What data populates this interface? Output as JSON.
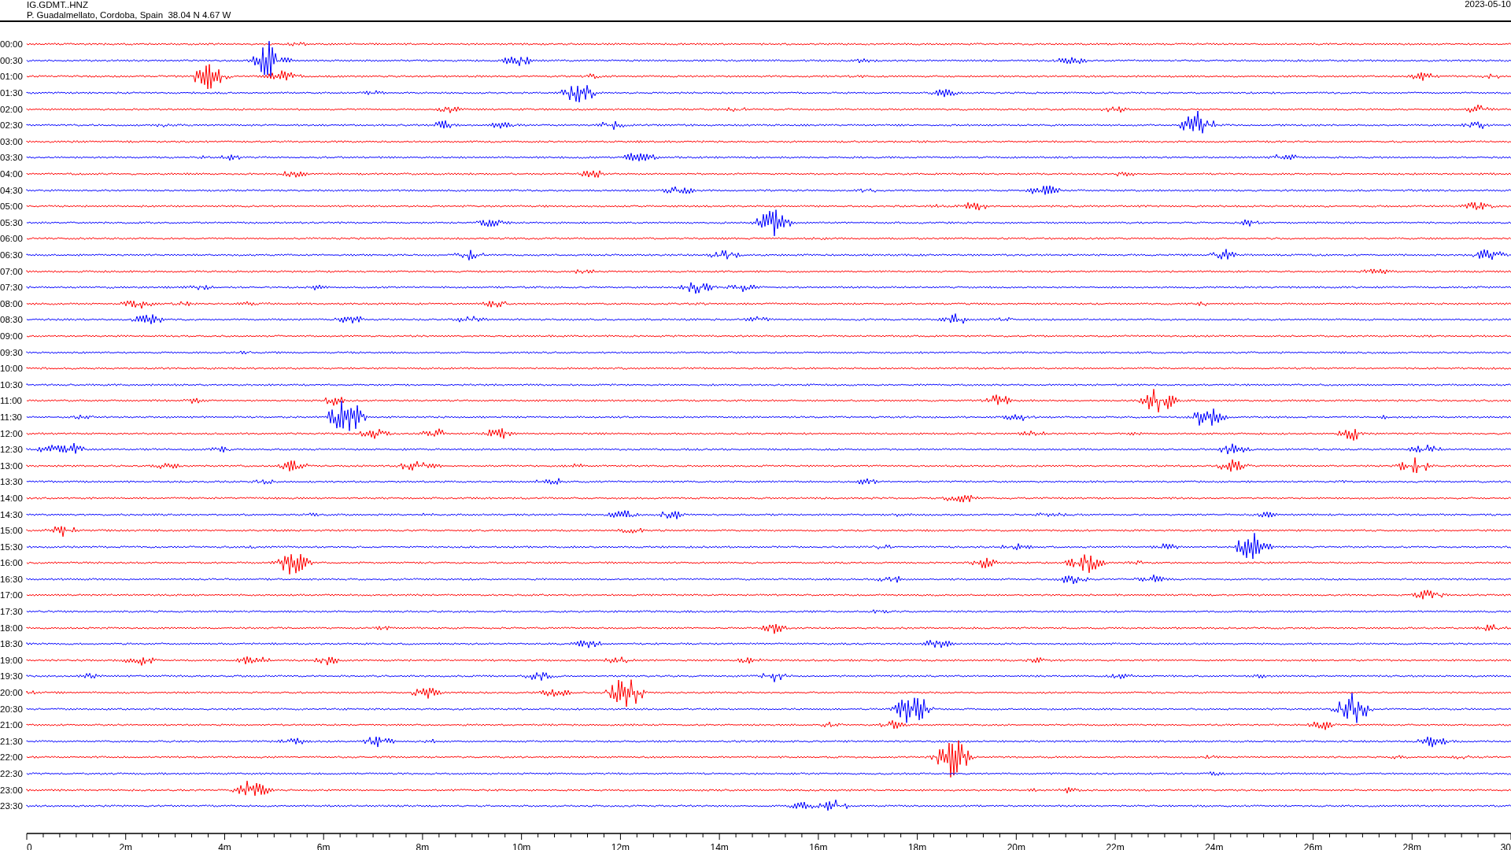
{
  "header": {
    "station": "IG.GDMT..HNZ",
    "location": "P. Guadalmellato, Cordoba, Spain  38.04 N 4.67 W",
    "date": "2023-05-10"
  },
  "rows": [
    {
      "time": "00:00",
      "color": "#ff0000"
    },
    {
      "time": "00:30",
      "color": "#0000ff"
    },
    {
      "time": "01:00",
      "color": "#ff0000"
    },
    {
      "time": "01:30",
      "color": "#0000ff"
    },
    {
      "time": "02:00",
      "color": "#ff0000"
    },
    {
      "time": "02:30",
      "color": "#0000ff"
    },
    {
      "time": "03:00",
      "color": "#ff0000"
    },
    {
      "time": "03:30",
      "color": "#0000ff"
    },
    {
      "time": "04:00",
      "color": "#ff0000"
    },
    {
      "time": "04:30",
      "color": "#0000ff"
    },
    {
      "time": "05:00",
      "color": "#ff0000"
    },
    {
      "time": "05:30",
      "color": "#0000ff"
    },
    {
      "time": "06:00",
      "color": "#ff0000"
    },
    {
      "time": "06:30",
      "color": "#0000ff"
    },
    {
      "time": "07:00",
      "color": "#ff0000"
    },
    {
      "time": "07:30",
      "color": "#0000ff"
    },
    {
      "time": "08:00",
      "color": "#ff0000"
    },
    {
      "time": "08:30",
      "color": "#0000ff"
    },
    {
      "time": "09:00",
      "color": "#ff0000"
    },
    {
      "time": "09:30",
      "color": "#0000ff"
    },
    {
      "time": "10:00",
      "color": "#ff0000"
    },
    {
      "time": "10:30",
      "color": "#0000ff"
    },
    {
      "time": "11:00",
      "color": "#ff0000"
    },
    {
      "time": "11:30",
      "color": "#0000ff"
    },
    {
      "time": "12:00",
      "color": "#ff0000"
    },
    {
      "time": "12:30",
      "color": "#0000ff"
    },
    {
      "time": "13:00",
      "color": "#ff0000"
    },
    {
      "time": "13:30",
      "color": "#0000ff"
    },
    {
      "time": "14:00",
      "color": "#ff0000"
    },
    {
      "time": "14:30",
      "color": "#0000ff"
    },
    {
      "time": "15:00",
      "color": "#ff0000"
    },
    {
      "time": "15:30",
      "color": "#0000ff"
    },
    {
      "time": "16:00",
      "color": "#ff0000"
    },
    {
      "time": "16:30",
      "color": "#0000ff"
    },
    {
      "time": "17:00",
      "color": "#ff0000"
    },
    {
      "time": "17:30",
      "color": "#0000ff"
    },
    {
      "time": "18:00",
      "color": "#ff0000"
    },
    {
      "time": "18:30",
      "color": "#0000ff"
    },
    {
      "time": "19:00",
      "color": "#ff0000"
    },
    {
      "time": "19:30",
      "color": "#0000ff"
    },
    {
      "time": "20:00",
      "color": "#ff0000"
    },
    {
      "time": "20:30",
      "color": "#0000ff"
    },
    {
      "time": "21:00",
      "color": "#ff0000"
    },
    {
      "time": "21:30",
      "color": "#0000ff"
    },
    {
      "time": "22:00",
      "color": "#ff0000"
    },
    {
      "time": "22:30",
      "color": "#0000ff"
    },
    {
      "time": "23:00",
      "color": "#ff0000"
    },
    {
      "time": "23:30",
      "color": "#0000ff"
    }
  ],
  "x_axis": {
    "labels": [
      "0",
      "2m",
      "4m",
      "6m",
      "8m",
      "10m",
      "12m",
      "14m",
      "16m",
      "18m",
      "20m",
      "22m",
      "24m",
      "26m",
      "28m",
      "30"
    ]
  }
}
